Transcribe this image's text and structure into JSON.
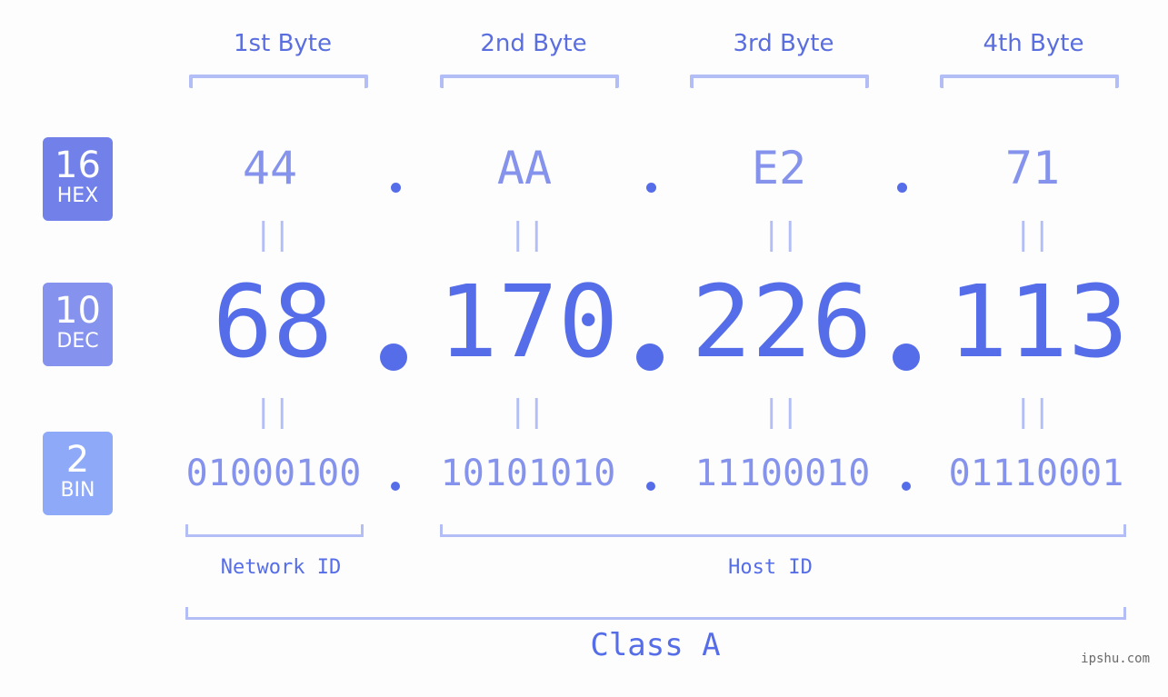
{
  "badges": [
    {
      "base": "16",
      "label": "HEX",
      "color": "#7281ea"
    },
    {
      "base": "10",
      "label": "DEC",
      "color": "#8593ef"
    },
    {
      "base": "2",
      "label": "BIN",
      "color": "#8ea9f8"
    }
  ],
  "bytes": [
    {
      "header": "1st Byte",
      "hex": "44",
      "dec": "68",
      "bin": "01000100"
    },
    {
      "header": "2nd Byte",
      "hex": "AA",
      "dec": "170",
      "bin": "10101010"
    },
    {
      "header": "3rd Byte",
      "hex": "E2",
      "dec": "226",
      "bin": "11100010"
    },
    {
      "header": "4th Byte",
      "hex": "71",
      "dec": "113",
      "bin": "01110001"
    }
  ],
  "equals_glyph": "||",
  "separator": ".",
  "segments": {
    "network_id": "Network ID",
    "host_id": "Host ID"
  },
  "ip_class": "Class A",
  "watermark": "ipshu.com",
  "colors": {
    "accent": "#566de9",
    "light": "#8593ec",
    "bracket": "#b3bdf6",
    "background": "#fcfdfc"
  }
}
